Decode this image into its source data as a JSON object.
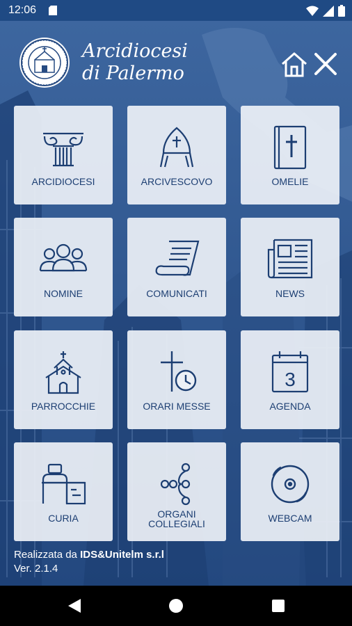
{
  "status": {
    "time": "12:06"
  },
  "header": {
    "title_line1": "Arcidiocesi",
    "title_line2": "di Palermo"
  },
  "tiles": [
    {
      "label": "ARCIDIOCESI"
    },
    {
      "label": "ARCIVESCOVO"
    },
    {
      "label": "OMELIE"
    },
    {
      "label": "NOMINE"
    },
    {
      "label": "COMUNICATI"
    },
    {
      "label": "NEWS"
    },
    {
      "label": "PARROCCHIE"
    },
    {
      "label": "ORARI MESSE"
    },
    {
      "label": "AGENDA"
    },
    {
      "label": "CURIA"
    },
    {
      "label_line1": "ORGANI",
      "label_line2": "COLLEGIALI"
    },
    {
      "label": "WEBCAM"
    }
  ],
  "footer": {
    "made_by_prefix": "Realizzata da ",
    "made_by_company": "IDS&Unitelm s.r.l",
    "version": "Ver. 2.1.4"
  },
  "colors": {
    "status_bar": "#1f4a84",
    "tile_bg": "#ecf0f6",
    "tile_text": "#1c3e72",
    "nav_bar": "#000000"
  }
}
